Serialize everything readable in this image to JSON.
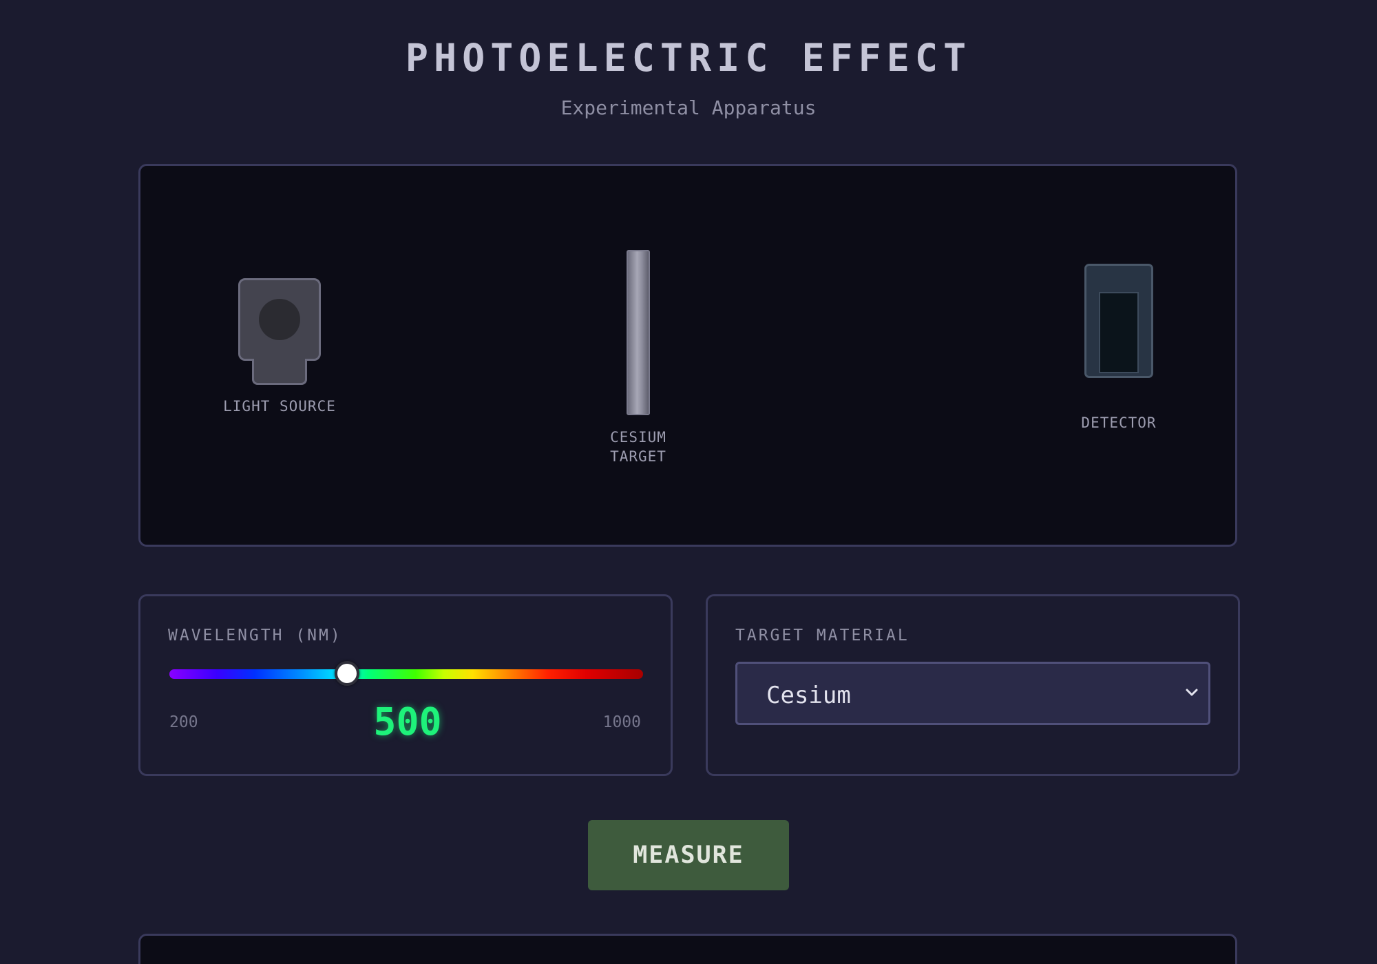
{
  "header": {
    "title": "PHOTOELECTRIC EFFECT",
    "subtitle": "Experimental Apparatus"
  },
  "apparatus": {
    "light_source_label": "LIGHT SOURCE",
    "target_label_line1": "CESIUM",
    "target_label_line2": "TARGET",
    "detector_label": "DETECTOR"
  },
  "wavelength": {
    "label": "WAVELENGTH (NM)",
    "min": 200,
    "max": 1000,
    "value": 500,
    "min_label": "200",
    "max_label": "1000",
    "value_label": "500"
  },
  "material": {
    "label": "TARGET MATERIAL",
    "selected": "Cesium"
  },
  "actions": {
    "measure_label": "MEASURE"
  },
  "colors": {
    "accent_value": "#1ef27a",
    "measure_button": "#3e5b3d",
    "background": "#1b1b2f"
  },
  "icons": {
    "select": "chevron-down-icon"
  }
}
